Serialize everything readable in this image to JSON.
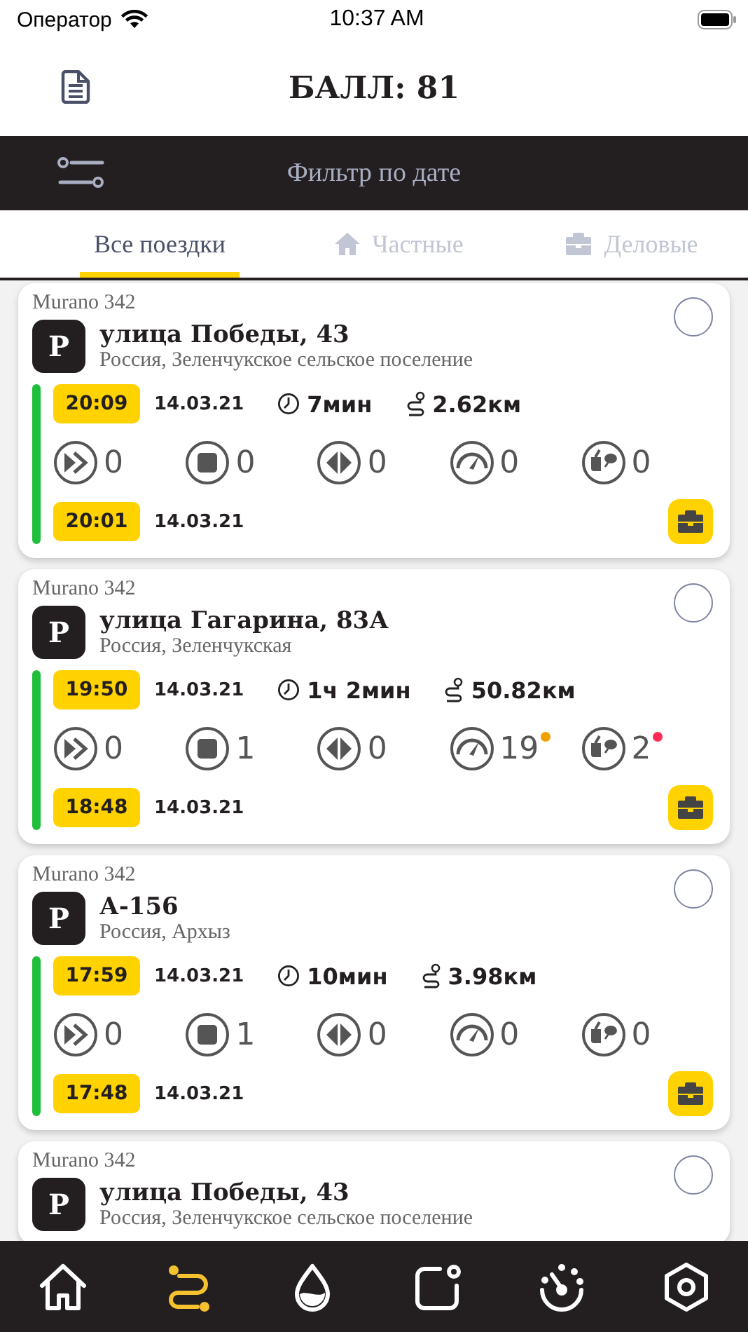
{
  "status_bar": {
    "carrier": "Оператор",
    "time": "10:37 AM"
  },
  "header": {
    "title": "БАЛЛ: 81"
  },
  "filter": {
    "label": "Фильтр по дате"
  },
  "tabs": [
    {
      "label": "Все поездки",
      "selected": true
    },
    {
      "label": "Частные",
      "selected": false
    },
    {
      "label": "Деловые",
      "selected": false
    }
  ],
  "trips": [
    {
      "vehicle": "Murano 342",
      "selected": false,
      "badge": "P",
      "street": "улица Победы, 43",
      "region": "Россия, Зеленчукское сельское поселение",
      "start_time": "20:09",
      "start_date": "14.03.21",
      "duration": "7мин",
      "distance": "2.62км",
      "stats": [
        {
          "kind": "acceleration",
          "value": "0"
        },
        {
          "kind": "braking",
          "value": "0"
        },
        {
          "kind": "turning",
          "value": "0"
        },
        {
          "kind": "speeding",
          "value": "0"
        },
        {
          "kind": "phone",
          "value": "0"
        }
      ],
      "end_time": "20:01",
      "end_date": "14.03.21",
      "business": true
    },
    {
      "vehicle": "Murano 342",
      "selected": false,
      "badge": "P",
      "street": "улица Гагарина, 83А",
      "region": "Россия, Зеленчукская",
      "start_time": "19:50",
      "start_date": "14.03.21",
      "duration": "1ч 2мин",
      "distance": "50.82км",
      "stats": [
        {
          "kind": "acceleration",
          "value": "0"
        },
        {
          "kind": "braking",
          "value": "1"
        },
        {
          "kind": "turning",
          "value": "0"
        },
        {
          "kind": "speeding",
          "value": "19",
          "color": "#f0a000"
        },
        {
          "kind": "phone",
          "value": "2",
          "color": "#ff2d55"
        }
      ],
      "end_time": "18:48",
      "end_date": "14.03.21",
      "business": true
    },
    {
      "vehicle": "Murano 342",
      "selected": false,
      "badge": "P",
      "street": "А-156",
      "region": "Россия, Архыз",
      "start_time": "17:59",
      "start_date": "14.03.21",
      "duration": "10мин",
      "distance": "3.98км",
      "stats": [
        {
          "kind": "acceleration",
          "value": "0"
        },
        {
          "kind": "braking",
          "value": "1"
        },
        {
          "kind": "turning",
          "value": "0"
        },
        {
          "kind": "speeding",
          "value": "0"
        },
        {
          "kind": "phone",
          "value": "0"
        }
      ],
      "end_time": "17:48",
      "end_date": "14.03.21",
      "business": true
    },
    {
      "vehicle": "Murano 342",
      "selected": false,
      "badge": "P",
      "street": "улица Победы, 43",
      "region": "Россия, Зеленчукское сельское поселение"
    }
  ],
  "nav": [
    {
      "kind": "home",
      "selected": false
    },
    {
      "kind": "trips",
      "selected": true
    },
    {
      "kind": "fuel",
      "selected": false
    },
    {
      "kind": "notifications",
      "selected": false
    },
    {
      "kind": "dashboard",
      "selected": false
    },
    {
      "kind": "settings",
      "selected": false
    }
  ]
}
